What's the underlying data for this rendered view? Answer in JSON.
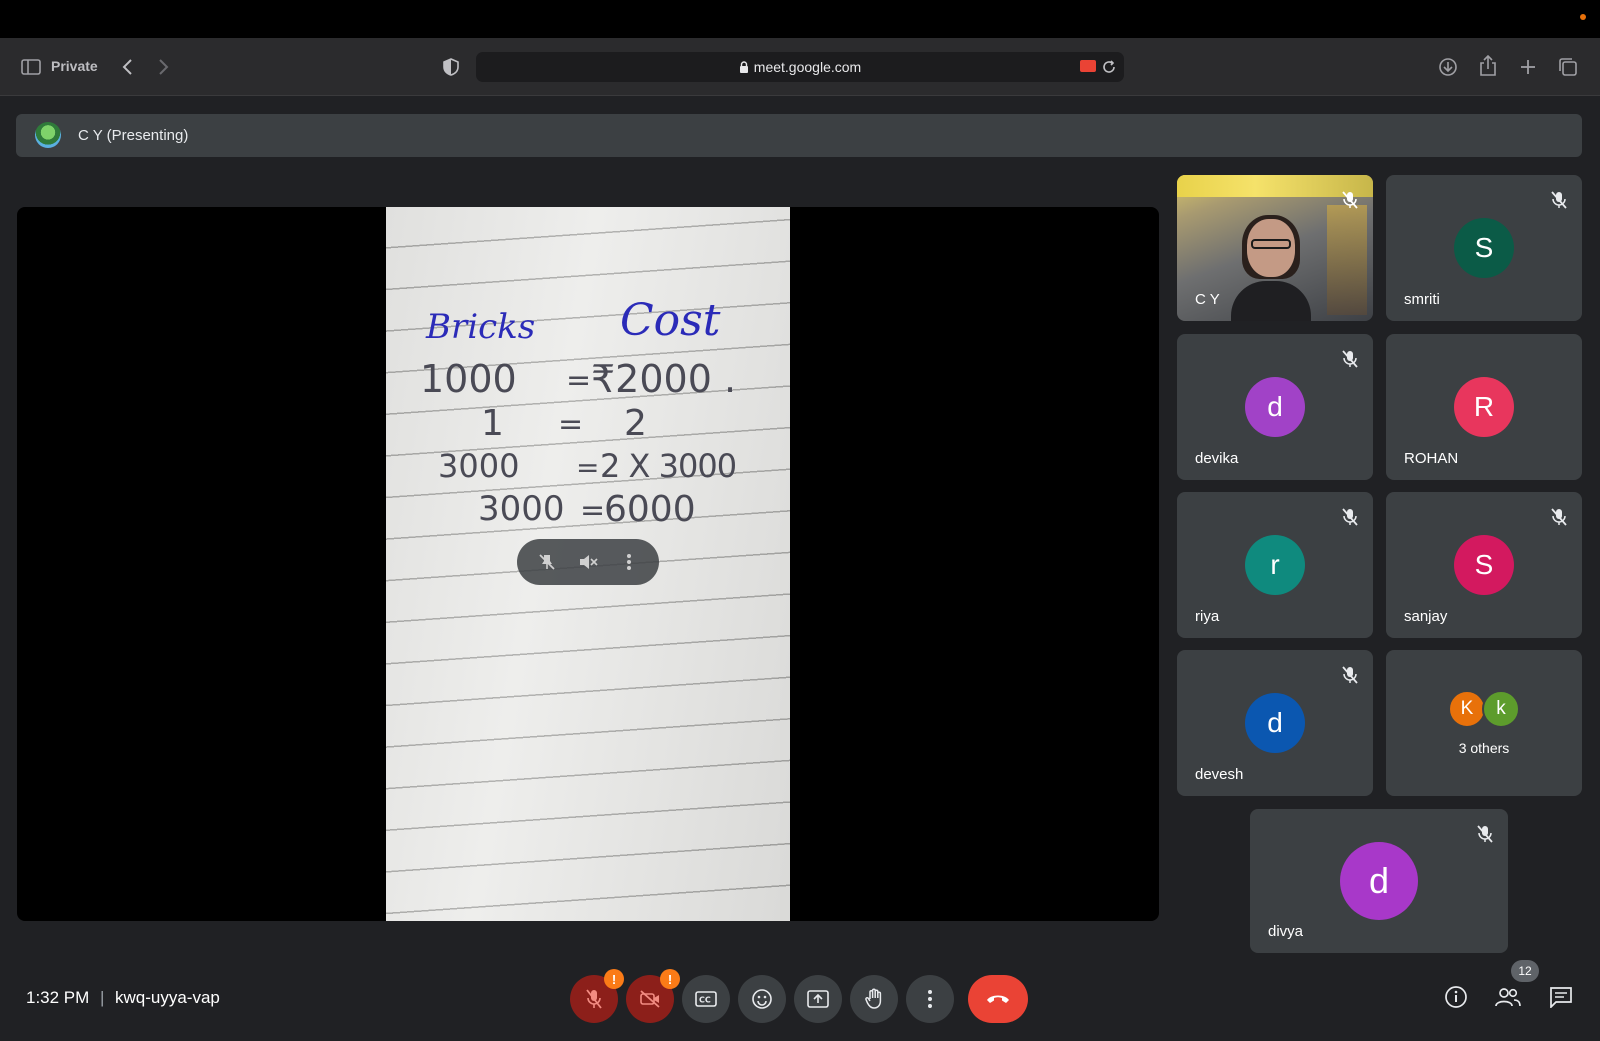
{
  "browser": {
    "private_label": "Private",
    "url": "meet.google.com"
  },
  "presenter_bar": {
    "text": "C Y (Presenting)"
  },
  "shared_screen": {
    "heading_left": "Bricks",
    "heading_right": "Cost",
    "rows": [
      {
        "left": "1000",
        "eq": "=",
        "right": "₹2000 ."
      },
      {
        "left": "1",
        "eq": "=",
        "right": "2"
      },
      {
        "left": "3000",
        "eq": "=",
        "right": "2 X 3000"
      },
      {
        "left": "3000",
        "eq": "=",
        "right": "6000"
      }
    ]
  },
  "participants": [
    {
      "name": "C Y",
      "type": "camera",
      "muted": true
    },
    {
      "name": "smriti",
      "initial": "S",
      "color": "#0b5b47",
      "muted": true
    },
    {
      "name": "devika",
      "initial": "d",
      "color": "#a142c7",
      "muted": true
    },
    {
      "name": "ROHAN",
      "initial": "R",
      "color": "#e8365d",
      "muted": false
    },
    {
      "name": "riya",
      "initial": "r",
      "color": "#0f8a7e",
      "muted": true
    },
    {
      "name": "sanjay",
      "initial": "S",
      "color": "#d3195f",
      "muted": true
    },
    {
      "name": "devesh",
      "initial": "d",
      "color": "#0b57b0",
      "muted": true
    },
    {
      "name": "divya",
      "initial": "d",
      "color": "#a838c9",
      "muted": true
    }
  ],
  "others": {
    "label": "3 others",
    "avatars": [
      {
        "initial": "K",
        "color": "#e8710a"
      },
      {
        "initial": "k",
        "color": "#5d9c2c"
      }
    ]
  },
  "bottom_bar": {
    "time": "1:32 PM",
    "separator": "|",
    "meeting_code": "kwq-uyya-vap",
    "participant_count": "12",
    "warning_mark": "!"
  }
}
